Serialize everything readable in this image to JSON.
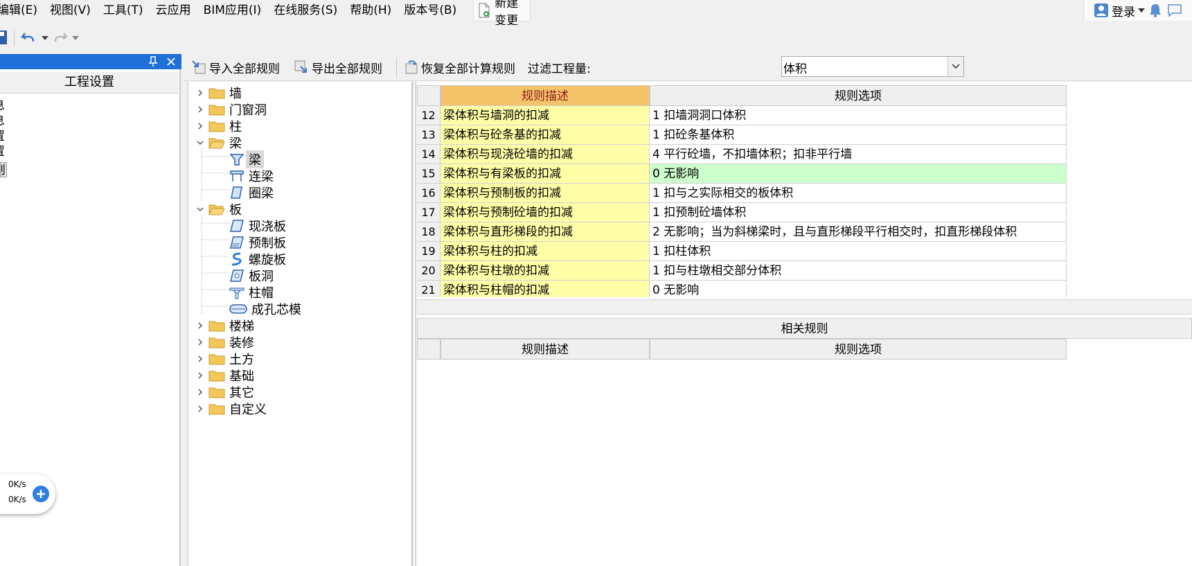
{
  "menu": {
    "items": [
      "编辑(E)",
      "视图(V)",
      "工具(T)",
      "云应用",
      "BIM应用(I)",
      "在线服务(S)",
      "帮助(H)",
      "版本号(B)"
    ],
    "new_change": "新建变更",
    "login": "登录"
  },
  "left_panel": {
    "tab_title": "工程设置",
    "clipped_items": [
      "息",
      "息",
      "置",
      "置",
      "则"
    ]
  },
  "net_widget": {
    "upload": "0K/s",
    "download": "0K/s"
  },
  "rules_toolbar": {
    "import_all": "导入全部规则",
    "export_all": "导出全部规则",
    "restore_all": "恢复全部计算规则",
    "filter_label": "过滤工程量:",
    "filter_value": "体积"
  },
  "tree": [
    {
      "label": "墙",
      "level": 0,
      "type": "folder",
      "expanded": false
    },
    {
      "label": "门窗洞",
      "level": 0,
      "type": "folder",
      "expanded": false
    },
    {
      "label": "柱",
      "level": 0,
      "type": "folder",
      "expanded": false
    },
    {
      "label": "梁",
      "level": 0,
      "type": "folder",
      "expanded": true
    },
    {
      "label": "梁",
      "level": 1,
      "type": "beam",
      "selected": true
    },
    {
      "label": "连梁",
      "level": 1,
      "type": "link-beam"
    },
    {
      "label": "圈梁",
      "level": 1,
      "type": "ring-beam"
    },
    {
      "label": "板",
      "level": 0,
      "type": "folder",
      "expanded": true
    },
    {
      "label": "现浇板",
      "level": 1,
      "type": "slab"
    },
    {
      "label": "预制板",
      "level": 1,
      "type": "precast-slab"
    },
    {
      "label": "螺旋板",
      "level": 1,
      "type": "spiral-slab"
    },
    {
      "label": "板洞",
      "level": 1,
      "type": "slab-hole"
    },
    {
      "label": "柱帽",
      "level": 1,
      "type": "column-cap"
    },
    {
      "label": "成孔芯模",
      "level": 1,
      "type": "core-mold"
    },
    {
      "label": "楼梯",
      "level": 0,
      "type": "folder",
      "expanded": false
    },
    {
      "label": "装修",
      "level": 0,
      "type": "folder",
      "expanded": false
    },
    {
      "label": "土方",
      "level": 0,
      "type": "folder",
      "expanded": false
    },
    {
      "label": "基础",
      "level": 0,
      "type": "folder",
      "expanded": false
    },
    {
      "label": "其它",
      "level": 0,
      "type": "folder",
      "expanded": false
    },
    {
      "label": "自定义",
      "level": 0,
      "type": "folder",
      "expanded": false
    }
  ],
  "grid": {
    "col_desc": "规则描述",
    "col_option": "规则选项",
    "rows": [
      {
        "num": "12",
        "desc": "梁体积与墙洞的扣减",
        "opt": "1  扣墙洞洞口体积"
      },
      {
        "num": "13",
        "desc": "梁体积与砼条基的扣减",
        "opt": "1  扣砼条基体积"
      },
      {
        "num": "14",
        "desc": "梁体积与现浇砼墙的扣减",
        "opt": "4  平行砼墙，不扣墙体积；扣非平行墙"
      },
      {
        "num": "15",
        "desc": "梁体积与有梁板的扣减",
        "opt": "0   无影响",
        "highlight": true
      },
      {
        "num": "16",
        "desc": "梁体积与预制板的扣减",
        "opt": "1  扣与之实际相交的板体积"
      },
      {
        "num": "17",
        "desc": "梁体积与预制砼墙的扣减",
        "opt": "1   扣预制砼墙体积"
      },
      {
        "num": "18",
        "desc": "梁体积与直形梯段的扣减",
        "opt": "2  无影响；当为斜梯梁时，且与直形梯段平行相交时，扣直形梯段体积"
      },
      {
        "num": "19",
        "desc": "梁体积与柱的扣减",
        "opt": "1  扣柱体积"
      },
      {
        "num": "20",
        "desc": "梁体积与柱墩的扣减",
        "opt": "1  扣与柱墩相交部分体积"
      },
      {
        "num": "21",
        "desc": "梁体积与柱帽的扣减",
        "opt": "0   无影响"
      }
    ]
  },
  "related": {
    "title": "相关规则",
    "col_desc": "规则描述",
    "col_option": "规则选项"
  },
  "colors": {
    "desc_cell": "#ffffa8",
    "highlight_row": "#ccffcc",
    "header_selected": "#f5c46a",
    "panel_header": "#1e6fd6"
  }
}
